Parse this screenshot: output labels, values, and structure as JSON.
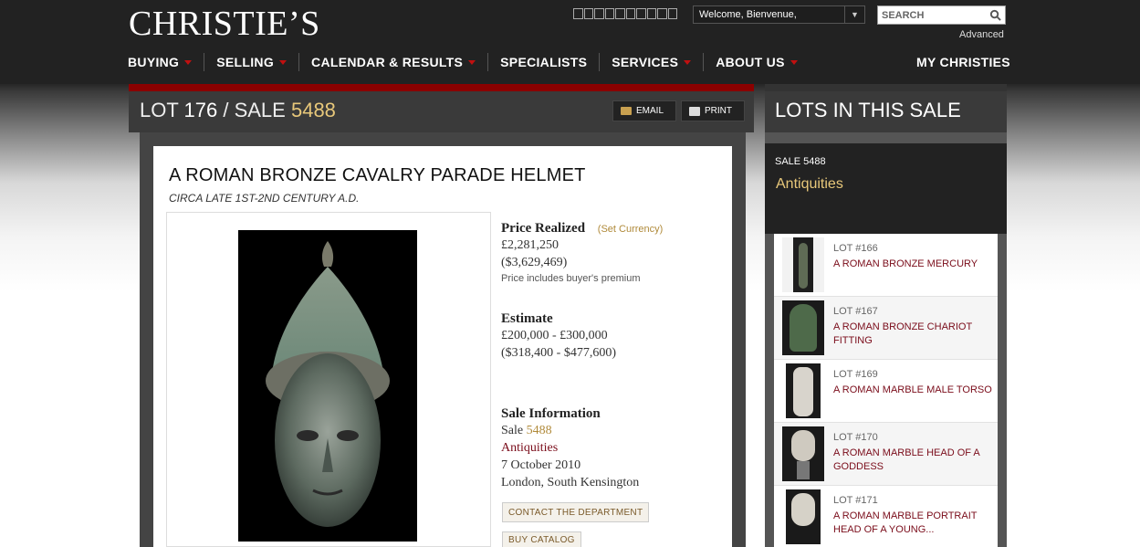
{
  "header": {
    "logo": "CHRISTIE’S",
    "welcome": "Welcome, Bienvenue,",
    "search_placeholder": "SEARCH",
    "advanced": "Advanced"
  },
  "nav": {
    "items": [
      {
        "label": "BUYING",
        "dropdown": true
      },
      {
        "label": "SELLING",
        "dropdown": true
      },
      {
        "label": "CALENDAR & RESULTS",
        "dropdown": true
      },
      {
        "label": "SPECIALISTS",
        "dropdown": false
      },
      {
        "label": "SERVICES",
        "dropdown": true
      },
      {
        "label": "ABOUT US",
        "dropdown": true
      }
    ],
    "my_christies": "MY CHRISTIES"
  },
  "lot": {
    "lot_label": "LOT",
    "lot_number": "176",
    "sale_label": "/ SALE",
    "sale_number": "5488",
    "email": "EMAIL",
    "print": "PRINT",
    "title": "A ROMAN BRONZE CAVALRY PARADE HELMET",
    "subtitle": "CIRCA LATE 1ST-2ND CENTURY A.D."
  },
  "price": {
    "heading": "Price Realized",
    "set_currency": "(Set Currency)",
    "gbp": "£2,281,250",
    "usd": "($3,629,469)",
    "note": "Price includes buyer's premium"
  },
  "estimate": {
    "heading": "Estimate",
    "gbp": "£200,000 - £300,000",
    "usd": "($318,400 - $477,600)"
  },
  "sale_info": {
    "heading": "Sale Information",
    "sale_prefix": "Sale",
    "sale_number": "5488",
    "name": "Antiquities",
    "date": "7 October 2010",
    "location": "London, South Kensington",
    "contact_button": "CONTACT THE DEPARTMENT",
    "catalog_button": "BUY CATALOG"
  },
  "sidebar": {
    "title": "LOTS IN THIS SALE",
    "sale_number": "SALE 5488",
    "sale_name": "Antiquities",
    "lots": [
      {
        "num": "LOT #166",
        "name": "A ROMAN BRONZE MERCURY"
      },
      {
        "num": "LOT #167",
        "name": "A ROMAN BRONZE CHARIOT FITTING"
      },
      {
        "num": "LOT #169",
        "name": "A ROMAN MARBLE MALE TORSO"
      },
      {
        "num": "LOT #170",
        "name": "A ROMAN MARBLE HEAD OF A GODDESS"
      },
      {
        "num": "LOT #171",
        "name": "A ROMAN MARBLE PORTRAIT HEAD OF A YOUNG..."
      }
    ]
  },
  "colors": {
    "accent_red": "#8b0000",
    "gold": "#e8c87a",
    "maroon_link": "#7a0c1a"
  }
}
